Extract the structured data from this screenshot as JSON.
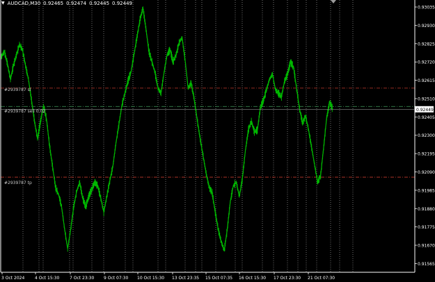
{
  "header": {
    "symbol": "AUDCAD,M30",
    "open": "0.92465",
    "high": "0.92474",
    "low": "0.92445",
    "close": "0.92449"
  },
  "orders": [
    {
      "label": "#2939787 sl",
      "price": 0.9257,
      "color": "#c0392b"
    },
    {
      "label": "#2939787 sell 0.02",
      "price": 0.92465,
      "color": "#3f9a5a"
    },
    {
      "label": "#2939787 tp",
      "price": 0.9206,
      "color": "#c0392b"
    }
  ],
  "current_price": {
    "value": 0.92449,
    "label": "0.92449"
  },
  "colors": {
    "background": "#000000",
    "candle": "#00c000",
    "grid": "#bdbdbd",
    "axis": "#ffffff"
  },
  "icons": {
    "collapse": "triangle-down-icon",
    "scroll": "scroll-shift-marker-icon"
  },
  "chart_data": {
    "type": "line",
    "ylim": [
      0.91515,
      0.93075
    ],
    "y_ticks": [
      "0.93035",
      "0.92930",
      "0.92825",
      "0.92720",
      "0.92615",
      "0.92510",
      "0.92405",
      "0.92300",
      "0.92195",
      "0.92090",
      "0.91985",
      "0.91880",
      "0.91775",
      "0.91670",
      "0.91565"
    ],
    "x_ticks": [
      "3 Oct 2024",
      "4 Oct 15:30",
      "7 Oct 23:30",
      "9 Oct 07:30",
      "10 Oct 15:30",
      "13 Oct 23:35",
      "15 Oct 07:35",
      "16 Oct 15:30",
      "17 Oct 23:30",
      "21 Oct 07:30"
    ],
    "series": [
      {
        "values": [
          0.9275,
          0.9278,
          0.9271,
          0.9262,
          0.927,
          0.9276,
          0.9282,
          0.9279,
          0.927,
          0.9262,
          0.925,
          0.9238,
          0.9228,
          0.9238,
          0.9247,
          0.9239,
          0.9224,
          0.9212,
          0.92,
          0.9196,
          0.9189,
          0.9176,
          0.9165,
          0.9176,
          0.9189,
          0.9198,
          0.9203,
          0.9194,
          0.9189,
          0.9195,
          0.9199,
          0.9203,
          0.9201,
          0.9194,
          0.9186,
          0.9195,
          0.9204,
          0.9212,
          0.9225,
          0.9236,
          0.9247,
          0.9254,
          0.9261,
          0.9266,
          0.9276,
          0.9286,
          0.9296,
          0.9303,
          0.9291,
          0.9278,
          0.9272,
          0.9266,
          0.9257,
          0.9254,
          0.9266,
          0.9276,
          0.9279,
          0.9272,
          0.9276,
          0.9283,
          0.9286,
          0.9273,
          0.9257,
          0.926,
          0.9251,
          0.9239,
          0.9228,
          0.9218,
          0.9208,
          0.92,
          0.9197,
          0.9186,
          0.9176,
          0.9169,
          0.9164,
          0.9176,
          0.9192,
          0.9201,
          0.9203,
          0.9195,
          0.9205,
          0.9221,
          0.9233,
          0.9238,
          0.9232,
          0.9233,
          0.9246,
          0.925,
          0.9256,
          0.9262,
          0.9265,
          0.9256,
          0.9254,
          0.9252,
          0.9261,
          0.9265,
          0.9272,
          0.9269,
          0.9257,
          0.9245,
          0.9237,
          0.9241,
          0.9233,
          0.9223,
          0.9213,
          0.9203,
          0.9207,
          0.9223,
          0.924,
          0.9249,
          0.9245
        ]
      }
    ]
  }
}
